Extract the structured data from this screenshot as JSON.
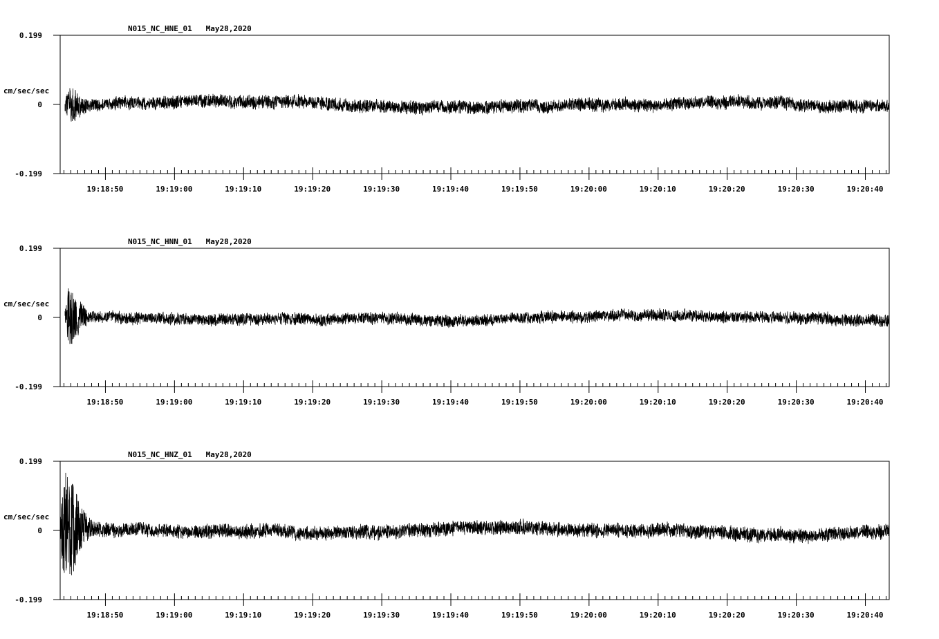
{
  "chart_data": [
    {
      "type": "line",
      "title": "N015_NC_HNE_01   May28,2020",
      "ylabel": "cm/sec/sec",
      "ylim": [
        -0.199,
        0.199
      ],
      "y_tick_labels": [
        "0.199",
        "0",
        "-0.199"
      ],
      "x_tick_labels": [
        "19:18:50",
        "19:19:00",
        "19:19:10",
        "19:19:20",
        "19:19:30",
        "19:19:40",
        "19:19:50",
        "19:20:00",
        "19:20:10",
        "19:20:20",
        "19:20:30",
        "19:20:40"
      ],
      "xlim_seconds": [
        -6.5,
        113.5
      ],
      "signal": {
        "start_s": -5.8,
        "noise_amp": 0.022,
        "onset_amp": 0.03,
        "onset_width_s": 1.5,
        "color": "#000000"
      }
    },
    {
      "type": "line",
      "title": "N015_NC_HNN_01   May28,2020",
      "ylabel": "cm/sec/sec",
      "ylim": [
        -0.199,
        0.199
      ],
      "y_tick_labels": [
        "0.199",
        "0",
        "-0.199"
      ],
      "x_tick_labels": [
        "19:18:50",
        "19:19:00",
        "19:19:10",
        "19:19:20",
        "19:19:30",
        "19:19:40",
        "19:19:50",
        "19:20:00",
        "19:20:10",
        "19:20:20",
        "19:20:30",
        "19:20:40"
      ],
      "xlim_seconds": [
        -6.5,
        113.5
      ],
      "signal": {
        "start_s": -5.8,
        "noise_amp": 0.02,
        "onset_amp": 0.068,
        "onset_width_s": 1.6,
        "color": "#000000"
      }
    },
    {
      "type": "line",
      "title": "N015_NC_HNZ_01   May28,2020",
      "ylabel": "cm/sec/sec",
      "ylim": [
        -0.199,
        0.199
      ],
      "y_tick_labels": [
        "0.199",
        "0",
        "-0.199"
      ],
      "x_tick_labels": [
        "19:18:50",
        "19:19:00",
        "19:19:10",
        "19:19:20",
        "19:19:30",
        "19:19:40",
        "19:19:50",
        "19:20:00",
        "19:20:10",
        "19:20:20",
        "19:20:30",
        "19:20:40"
      ],
      "xlim_seconds": [
        -6.5,
        113.5
      ],
      "signal": {
        "start_s": -6.5,
        "noise_amp": 0.024,
        "onset_amp": 0.14,
        "onset_width_s": 2.2,
        "color": "#000000"
      }
    }
  ]
}
